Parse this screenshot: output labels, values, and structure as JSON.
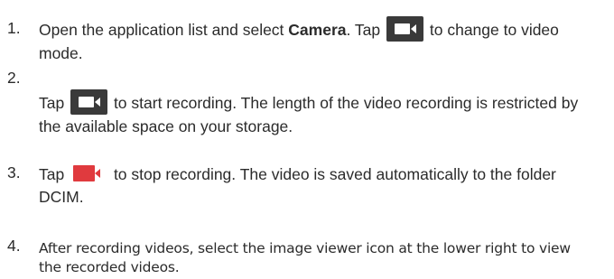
{
  "steps": [
    {
      "number": "1.",
      "line1_pre": "Open the application list and select ",
      "line1_bold": "Camera",
      "line1_mid": ". Tap ",
      "line1_post": " to change to video",
      "line2": "mode."
    },
    {
      "number": "2.",
      "line1_pre": "Tap ",
      "line1_post": " to start recording. The length of the video recording is restricted by",
      "line2": "the available space on your storage."
    },
    {
      "number": "3.",
      "line1_pre": "Tap ",
      "line1_post": "  to stop recording. The video is saved automatically to the folder",
      "line2": "DCIM."
    },
    {
      "number": "4.",
      "line1": "After recording videos, select the image viewer icon at the lower right to view",
      "line2": "the recorded videos."
    }
  ],
  "icons": {
    "video_mode": "video-camera-icon",
    "record": "video-camera-icon",
    "stop": "video-camera-recording-icon"
  },
  "colors": {
    "text": "#2b2b2b",
    "icon_bg": "#3a3a3a",
    "record_red": "#e03a3e"
  }
}
